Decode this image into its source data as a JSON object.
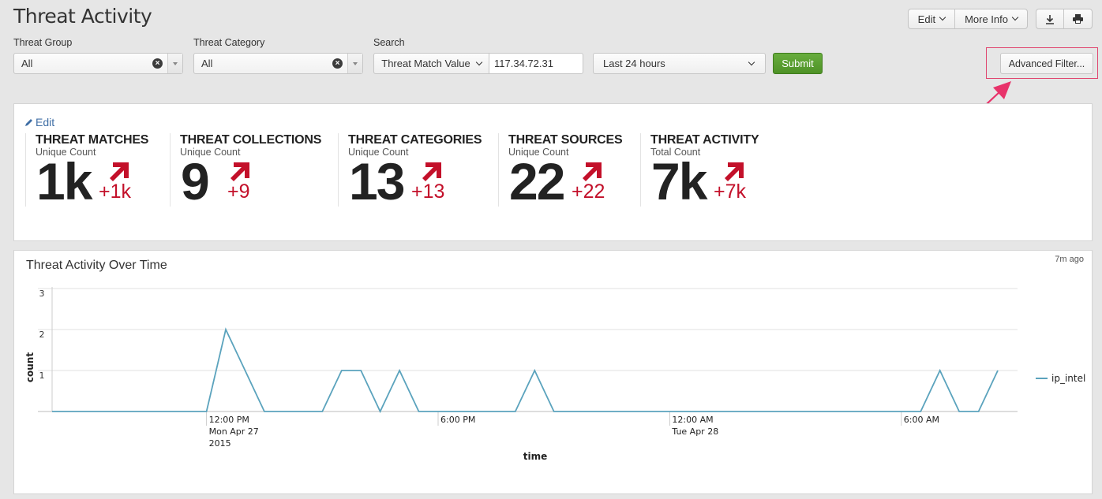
{
  "header": {
    "title": "Threat Activity",
    "edit_label": "Edit",
    "more_info_label": "More Info",
    "download_icon": "download-icon",
    "print_icon": "print-icon"
  },
  "filters": {
    "threat_group": {
      "label": "Threat Group",
      "value": "All"
    },
    "threat_category": {
      "label": "Threat Category",
      "value": "All"
    },
    "search": {
      "label": "Search",
      "type_value": "Threat Match Value",
      "value": "117.34.72.31"
    },
    "time_range": {
      "value": "Last 24 hours"
    },
    "submit_label": "Submit",
    "advanced_filter_label": "Advanced Filter..."
  },
  "annotation": {
    "color": "#e0466f"
  },
  "kpi_panel": {
    "edit_label": "Edit",
    "trend_color": "#c3102a",
    "items": [
      {
        "title": "THREAT MATCHES",
        "subtitle": "Unique Count",
        "value": "1k",
        "delta": "+1k",
        "trend": "up"
      },
      {
        "title": "THREAT COLLECTIONS",
        "subtitle": "Unique Count",
        "value": "9",
        "delta": "+9",
        "trend": "up"
      },
      {
        "title": "THREAT CATEGORIES",
        "subtitle": "Unique Count",
        "value": "13",
        "delta": "+13",
        "trend": "up"
      },
      {
        "title": "THREAT SOURCES",
        "subtitle": "Unique Count",
        "value": "22",
        "delta": "+22",
        "trend": "up"
      },
      {
        "title": "THREAT ACTIVITY",
        "subtitle": "Total Count",
        "value": "7k",
        "delta": "+7k",
        "trend": "up"
      }
    ]
  },
  "chart_panel": {
    "title": "Threat Activity Over Time",
    "refreshed": "7m ago"
  },
  "chart_data": {
    "type": "line",
    "title": "Threat Activity Over Time",
    "xlabel": "time",
    "ylabel": "count",
    "ylim": [
      0,
      3
    ],
    "yticks": [
      1,
      2,
      3
    ],
    "grid": true,
    "legend": "right",
    "x_start": "4:00 AM Mon Apr 27 2015",
    "x_interval": "1 hour",
    "xticks": [
      {
        "index": 8,
        "lines": [
          "12:00 PM",
          "Mon Apr 27",
          "2015"
        ]
      },
      {
        "index": 20,
        "lines": [
          "6:00 PM"
        ]
      },
      {
        "index": 32,
        "lines": [
          "12:00 AM",
          "Tue Apr 28"
        ]
      },
      {
        "index": 44,
        "lines": [
          "6:00 AM"
        ]
      }
    ],
    "series": [
      {
        "name": "ip_intel",
        "color": "#5ba3bd",
        "values": [
          0,
          0,
          0,
          0,
          0,
          0,
          0,
          0,
          0,
          2,
          1,
          0,
          0,
          0,
          0,
          1,
          1,
          0,
          1,
          0,
          0,
          0,
          0,
          0,
          0,
          1,
          0,
          0,
          0,
          0,
          0,
          0,
          0,
          0,
          0,
          0,
          0,
          0,
          0,
          0,
          0,
          0,
          0,
          0,
          0,
          0,
          1,
          0,
          0,
          1
        ]
      }
    ]
  }
}
